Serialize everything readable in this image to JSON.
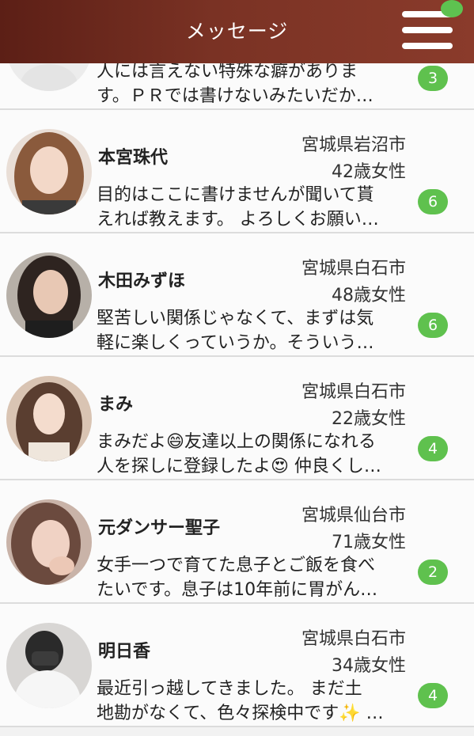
{
  "header": {
    "title": "メッセージ",
    "accent_color": "#5ec250",
    "menu_icon": "hamburger-menu-icon"
  },
  "messages": [
    {
      "name": "",
      "location": "",
      "age": "",
      "line1": "人には言えない特殊な癖がありま",
      "line2": "す。ＰＲでは書けないみたいだか…",
      "unread": "3"
    },
    {
      "name": "本宮珠代",
      "location": "宮城県岩沼市",
      "age": "42歳女性",
      "line1": "目的はここに書けませんが聞いて貰",
      "line2": "えれば教えます。 よろしくお願い…",
      "unread": "6"
    },
    {
      "name": "木田みずほ",
      "location": "宮城県白石市",
      "age": "48歳女性",
      "line1": "堅苦しい関係じゃなくて、まずは気",
      "line2": "軽に楽しくっていうか。そういう…",
      "unread": "6"
    },
    {
      "name": "まみ",
      "location": "宮城県白石市",
      "age": "22歳女性",
      "line1": "まみだよ😄友達以上の関係になれる",
      "line2": "人を探しに登録したよ😍 仲良くし…",
      "unread": "4"
    },
    {
      "name": "元ダンサー聖子",
      "location": "宮城県仙台市",
      "age": "71歳女性",
      "line1": "女手一つで育てた息子とご飯を食べ",
      "line2": "たいです。息子は10年前に胃がん…",
      "unread": "2"
    },
    {
      "name": "明日香",
      "location": "宮城県白石市",
      "age": "34歳女性",
      "line1": "最近引っ越してきました。 まだ土",
      "line2": "地勘がなくて、色々探検中です✨ …",
      "unread": "4"
    }
  ]
}
